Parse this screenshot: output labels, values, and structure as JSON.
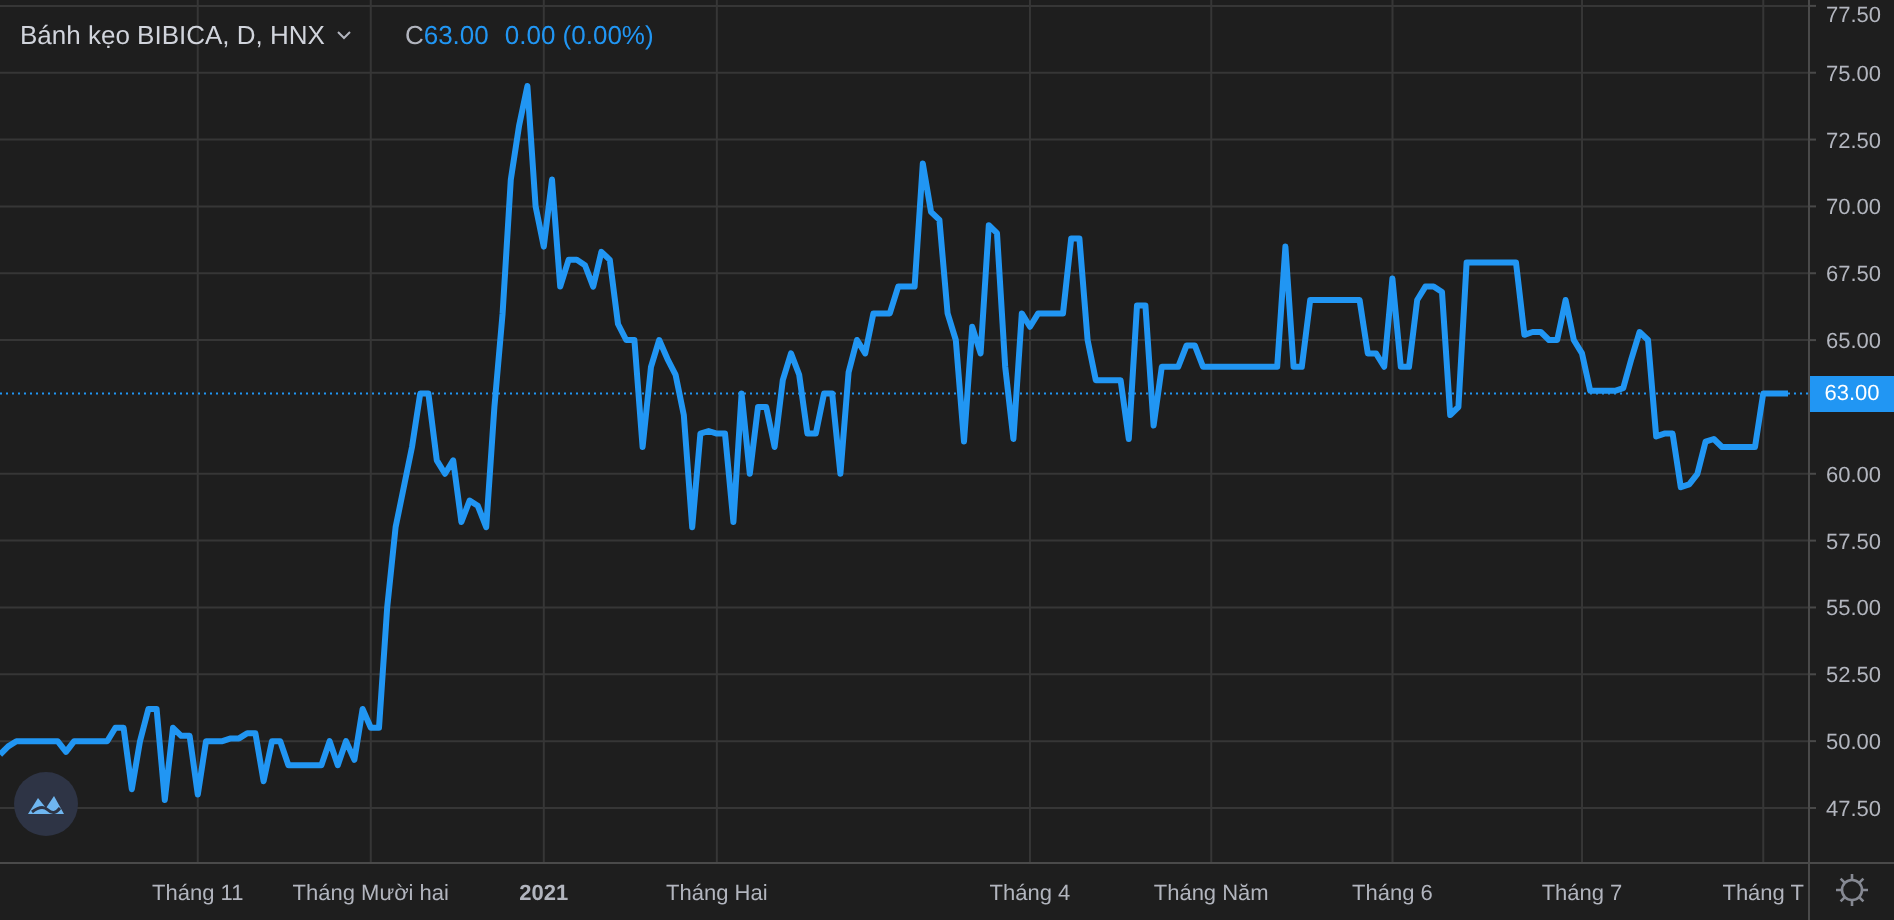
{
  "legend": {
    "title": "Bánh kẹo BIBICA, D, HNX",
    "close_label": "C",
    "close_value": "63.00",
    "change": "0.00 (0.00%)"
  },
  "last_price_label": "63.00",
  "chart_data": {
    "type": "line",
    "grid": true,
    "categories": [
      null,
      null,
      null,
      null,
      null,
      null,
      null,
      null,
      null,
      null,
      null,
      null,
      null,
      null,
      null,
      null,
      null,
      null,
      null,
      null,
      null,
      null,
      null,
      null,
      "Tháng 11",
      null,
      null,
      null,
      null,
      null,
      null,
      null,
      null,
      null,
      null,
      null,
      null,
      null,
      null,
      null,
      null,
      null,
      null,
      null,
      null,
      "Tháng Mười hai",
      null,
      null,
      null,
      null,
      null,
      null,
      null,
      null,
      null,
      null,
      null,
      null,
      null,
      null,
      null,
      null,
      null,
      null,
      null,
      null,
      "2021",
      null,
      null,
      null,
      null,
      null,
      null,
      null,
      null,
      null,
      null,
      null,
      null,
      null,
      null,
      null,
      null,
      null,
      null,
      null,
      null,
      "Tháng Hai",
      null,
      null,
      null,
      null,
      null,
      null,
      null,
      null,
      null,
      null,
      null,
      null,
      null,
      null,
      null,
      null,
      null,
      null,
      null,
      null,
      null,
      null,
      null,
      null,
      null,
      null,
      null,
      null,
      null,
      null,
      null,
      null,
      null,
      null,
      null,
      null,
      null,
      "Tháng 4",
      null,
      null,
      null,
      null,
      null,
      null,
      null,
      null,
      null,
      null,
      null,
      null,
      null,
      null,
      null,
      null,
      null,
      null,
      null,
      null,
      null,
      "Tháng Năm",
      null,
      null,
      null,
      null,
      null,
      null,
      null,
      null,
      null,
      null,
      null,
      null,
      null,
      null,
      null,
      null,
      null,
      null,
      null,
      null,
      null,
      "Tháng 6",
      null,
      null,
      null,
      null,
      null,
      null,
      null,
      null,
      null,
      null,
      null,
      null,
      null,
      null,
      null,
      null,
      null,
      null,
      null,
      null,
      null,
      null,
      "Tháng 7",
      null,
      null,
      null,
      null,
      null,
      null,
      null,
      null,
      null,
      null,
      null,
      null,
      null,
      null,
      null,
      null,
      null,
      null,
      null,
      null,
      null,
      "Tháng T",
      null,
      null,
      null
    ],
    "series": [
      {
        "color": "#2196f3",
        "values": [
          49.5,
          49.8,
          50,
          50,
          50,
          50,
          50,
          50,
          49.6,
          50,
          50,
          50,
          50,
          50,
          50.5,
          50.5,
          48.2,
          50,
          51.2,
          51.2,
          47.8,
          50.5,
          50.2,
          50.2,
          48,
          50,
          50,
          50,
          50.1,
          50.1,
          50.3,
          50.3,
          48.5,
          50,
          50,
          49.1,
          49.1,
          49.1,
          49.1,
          49.1,
          50,
          49.1,
          50,
          49.3,
          51.2,
          50.5,
          50.5,
          55,
          58,
          59.5,
          61,
          63,
          63,
          60.5,
          60,
          60.5,
          58.2,
          59,
          58.8,
          58,
          62.5,
          66,
          71,
          73,
          74.5,
          70,
          68.5,
          71,
          67,
          68,
          68,
          67.8,
          67,
          68.3,
          68,
          65.6,
          65,
          65,
          61,
          64,
          65,
          64.3,
          63.7,
          62.2,
          58,
          61.5,
          61.6,
          61.5,
          61.5,
          58.2,
          63,
          60,
          62.5,
          62.5,
          61,
          63.5,
          64.5,
          63.7,
          61.5,
          61.5,
          63,
          63,
          60,
          63.8,
          65,
          64.5,
          66,
          66,
          66,
          67,
          67,
          67,
          71.6,
          69.8,
          69.5,
          66,
          65,
          61.2,
          65.5,
          64.5,
          69.3,
          69,
          64,
          61.3,
          66,
          65.5,
          66,
          66,
          66,
          66,
          68.8,
          68.8,
          65,
          63.5,
          63.5,
          63.5,
          63.5,
          61.3,
          66.3,
          66.3,
          61.8,
          64,
          64,
          64,
          64.8,
          64.8,
          64,
          64,
          64,
          64,
          64,
          64,
          64,
          64,
          64,
          64,
          68.5,
          64,
          64,
          66.5,
          66.5,
          66.5,
          66.5,
          66.5,
          66.5,
          66.5,
          64.5,
          64.5,
          64,
          67.3,
          64,
          64,
          66.5,
          67,
          67,
          66.8,
          62.2,
          62.5,
          67.9,
          67.9,
          67.9,
          67.9,
          67.9,
          67.9,
          67.9,
          65.2,
          65.3,
          65.3,
          65,
          65,
          66.5,
          65,
          64.5,
          63.1,
          63.1,
          63.1,
          63.1,
          63.2,
          64.3,
          65.3,
          65,
          61.4,
          61.5,
          61.5,
          59.5,
          59.6,
          60,
          61.2,
          61.3,
          61,
          61,
          61,
          61,
          61,
          63,
          63,
          63,
          63
        ]
      }
    ],
    "ref_lines": [
      {
        "axis": "y",
        "value": 63
      }
    ],
    "ylim": [
      45.48,
      77.72
    ],
    "yticks": [
      {
        "value": 47.5,
        "label": "47.50"
      },
      {
        "value": 50,
        "label": "50.00"
      },
      {
        "value": 52.5,
        "label": "52.50"
      },
      {
        "value": 55,
        "label": "55.00"
      },
      {
        "value": 57.5,
        "label": "57.50"
      },
      {
        "value": 60,
        "label": "60.00"
      },
      {
        "value": 65,
        "label": "65.00"
      },
      {
        "value": 67.5,
        "label": "67.50"
      },
      {
        "value": 70,
        "label": "70.00"
      },
      {
        "value": 72.5,
        "label": "72.50"
      },
      {
        "value": 75,
        "label": "75.00"
      },
      {
        "value": 77.5,
        "label": "77.50"
      }
    ]
  }
}
